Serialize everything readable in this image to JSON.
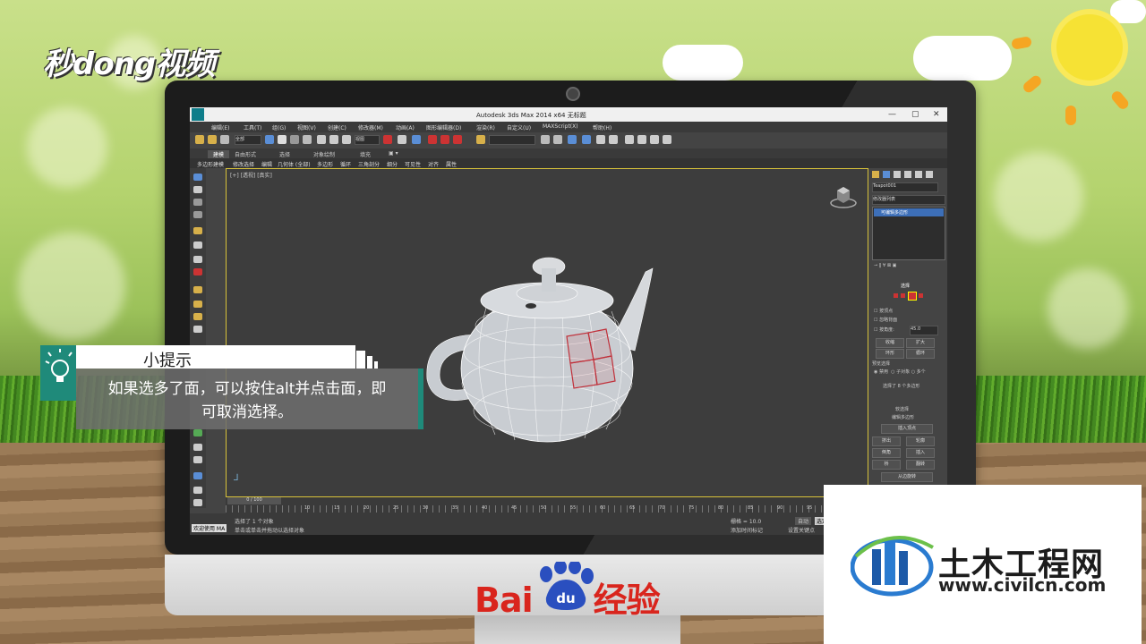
{
  "watermark": {
    "brand_left": "秒dong视频"
  },
  "app": {
    "title": "Autodesk 3ds Max  2014 x64     无标题",
    "menus": [
      "编辑(E)",
      "工具(T)",
      "组(G)",
      "视图(V)",
      "创建(C)",
      "修改器(M)",
      "动画(A)",
      "图形编辑器(D)",
      "渲染(R)",
      "自定义(U)",
      "MAXScript(X)",
      "帮助(H)"
    ],
    "toolbar": {
      "selection_filter": "全部",
      "view_dropdown": "视图"
    },
    "ribbon_tabs": [
      "建模",
      "自由形式",
      "选择",
      "对象绘制",
      "填充"
    ],
    "ribbon_items": [
      "多边形建模",
      "修改选择",
      "编辑",
      "几何体 (全部)",
      "多边形",
      "循环",
      "三角剖分",
      "细分",
      "可见性",
      "对齐",
      "属性"
    ],
    "viewport_label": "[+] [透视] [真实]",
    "command_panel": {
      "object_name": "Teapot001",
      "modifier_list": "修改器列表",
      "stack_item": "可编辑多边形",
      "rollout_selection": "选择",
      "by_vertex": "按顶点",
      "ignore_backfacing": "忽略背面",
      "by_angle": "按角度:",
      "angle_value": "45.0",
      "shrink": "收缩",
      "grow": "扩大",
      "ring": "环形",
      "loop": "循环",
      "preview_selection": "预览选择",
      "disabled": "禁用",
      "subobject": "子对象",
      "multi": "多个",
      "selected_info": "选择了 8 个多边形",
      "soft_selection": "软选择",
      "edit_polygons": "编辑多边形",
      "insert_vertex": "插入顶点",
      "extrude": "挤出",
      "outline": "轮廓",
      "bevel": "倒角",
      "inset": "插入",
      "bridge": "桥",
      "flip": "翻转",
      "hinge_from_edge": "从边旋转"
    },
    "timeline": {
      "frame": "0 / 100",
      "ticks": [
        "10",
        "15",
        "20",
        "25",
        "30",
        "35",
        "40",
        "45",
        "50",
        "55",
        "60",
        "65",
        "70",
        "75",
        "80",
        "85",
        "90",
        "95",
        "100"
      ]
    },
    "status": {
      "welcome": "欢迎使用 MA",
      "selected": "选择了 1 个对象",
      "hint": "单击或单击并拖动以选择对象",
      "grid": "栅格 = 10.0",
      "auto": "自动",
      "selected_obj": "选定对象",
      "add_time_tag": "添加时间标记",
      "set_key": "设置关键点"
    }
  },
  "tip": {
    "heading": "小提示",
    "line1": "如果选多了面，可以按住alt并点击面，即",
    "line2": "可取消选择。"
  },
  "monitor_brand": {
    "baidu": "Bai",
    "du": "du",
    "jingyan": "经验"
  },
  "civil_logo": {
    "title": "土木工程网",
    "url": "www.civilcn.com"
  },
  "colors": {
    "accent_teal": "#1f8a7a",
    "baidu_red": "#d9251d",
    "selection_red": "#c0303a"
  }
}
